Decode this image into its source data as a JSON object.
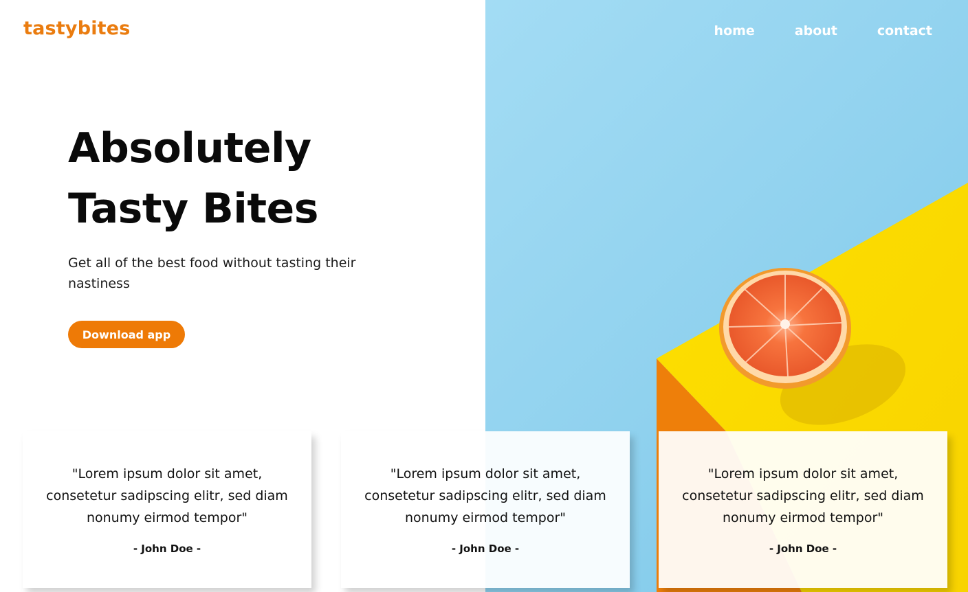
{
  "header": {
    "logo": "tastybites",
    "nav": [
      {
        "label": "home"
      },
      {
        "label": "about"
      },
      {
        "label": "contact"
      }
    ]
  },
  "hero": {
    "title_line1": "Absolutely",
    "title_line2": "Tasty Bites",
    "subtitle": "Get all of the best food without tasting their nastiness",
    "cta_label": "Download app"
  },
  "testimonials": [
    {
      "quote": "\"Lorem ipsum dolor sit amet, consetetur sadipscing elitr, sed diam nonumy eirmod tempor\"",
      "author": "- John Doe -"
    },
    {
      "quote": "\"Lorem ipsum dolor sit amet, consetetur sadipscing elitr, sed diam nonumy eirmod tempor\"",
      "author": "- John Doe -"
    },
    {
      "quote": "\"Lorem ipsum dolor sit amet, consetetur sadipscing elitr, sed diam nonumy eirmod tempor\"",
      "author": "- John Doe -"
    }
  ],
  "colors": {
    "brand": "#ea7c0f",
    "cta_background": "#ee7a06",
    "sky_blue": "#8fd1ee",
    "yellow": "#fcd900",
    "text_dark": "#0a0a0a"
  },
  "image": {
    "subject": "grapefruit-half-icon"
  }
}
